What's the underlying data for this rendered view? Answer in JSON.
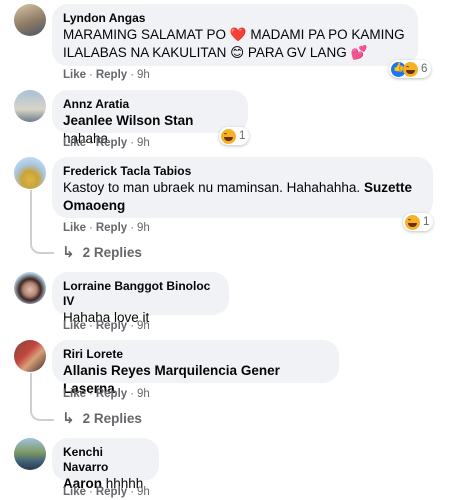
{
  "comments": [
    {
      "name": "Lyndon Angas",
      "text_line1": "MARAMING SALAMAT PO ",
      "heart": "❤️",
      "text_line1b": " MADAMI PA PO KAMING",
      "text_line2": "ILALABAS NA KAKULITAN ",
      "emoji2": "😊",
      "text_line2b": " PARA GV LANG ",
      "emoji3": "💕",
      "like": "Like",
      "reply": "Reply",
      "time": "9h",
      "reaction_count": "6",
      "avatar_colors": [
        "#c8b28f",
        "#5b6a7a"
      ]
    },
    {
      "name": "Annz Aratia",
      "mention": "Jeanlee Wilson Stan",
      "text": " hahaha",
      "like": "Like",
      "reply": "Reply",
      "time": "9h",
      "reaction_count": "1",
      "avatar_colors": [
        "#9bb5c9",
        "#e8e2d8"
      ]
    },
    {
      "name": "Frederick Tacla Tabios",
      "text": "Kastoy to man ubraek nu maminsan. Hahahahha. ",
      "mention_line1": "Suzette",
      "mention_line2": "Omaoeng",
      "like": "Like",
      "reply": "Reply",
      "time": "9h",
      "reaction_count": "1",
      "replies_label": "2 Replies",
      "avatar_colors": [
        "#a9c7e3",
        "#e3c04a"
      ]
    },
    {
      "name": "Lorraine Banggot Binoloc IV",
      "text": "Hahaha love it",
      "like": "Like",
      "reply": "Reply",
      "time": "9h",
      "avatar_colors": [
        "#b7d0e4",
        "#4a2e2a"
      ]
    },
    {
      "name": "Riri Lorete",
      "mention": "Allanis Reyes Marquilencia Gener Laserna",
      "like": "Like",
      "reply": "Reply",
      "time": "9h",
      "replies_label": "2 Replies",
      "avatar_colors": [
        "#6b4a3a",
        "#c63d3d"
      ]
    },
    {
      "name": "Kenchi Navarro",
      "mention": "Aaron",
      "text": " hhhhh",
      "like": "Like",
      "reply": "Reply",
      "time": "9h",
      "avatar_colors": [
        "#8aa06b",
        "#3d5f7a"
      ]
    }
  ]
}
